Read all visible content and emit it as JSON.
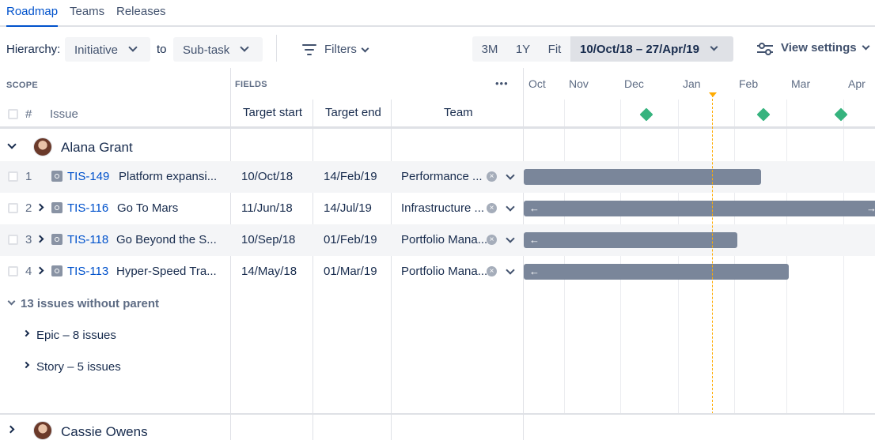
{
  "tabs": [
    {
      "label": "Roadmap",
      "active": true
    },
    {
      "label": "Teams",
      "active": false
    },
    {
      "label": "Releases",
      "active": false
    }
  ],
  "toolbar": {
    "hierarchy_label": "Hierarchy:",
    "hierarchy_from": "Initiative",
    "to_label": "to",
    "hierarchy_to": "Sub-task",
    "filters_label": "Filters",
    "range_3m": "3M",
    "range_1y": "1Y",
    "range_fit": "Fit",
    "date_range": "10/Oct/18 – 27/Apr/19",
    "view_settings": "View settings"
  },
  "columns": {
    "scope": "SCOPE",
    "fields": "FIELDS",
    "hash": "#",
    "issue": "Issue",
    "target_start": "Target start",
    "target_end": "Target end",
    "team": "Team",
    "more": "•••"
  },
  "months": [
    "Oct",
    "Nov",
    "Dec",
    "Jan",
    "Feb",
    "Mar",
    "Apr"
  ],
  "groups": [
    {
      "name": "Alana Grant",
      "expanded": true,
      "rows": [
        {
          "num": "1",
          "key": "TIS-149",
          "summary": "Platform expansi...",
          "start": "10/Oct/18",
          "end": "14/Feb/19",
          "team": "Performance ...",
          "has_children": false
        },
        {
          "num": "2",
          "key": "TIS-116",
          "summary": "Go To Mars",
          "start": "11/Jun/18",
          "end": "14/Jul/19",
          "team": "Infrastructure ...",
          "has_children": true
        },
        {
          "num": "3",
          "key": "TIS-118",
          "summary": "Go Beyond the S...",
          "start": "10/Sep/18",
          "end": "01/Feb/19",
          "team": "Portfolio Mana...",
          "has_children": true
        },
        {
          "num": "4",
          "key": "TIS-113",
          "summary": "Hyper-Speed Tra...",
          "start": "14/May/18",
          "end": "01/Mar/19",
          "team": "Portfolio Mana...",
          "has_children": true
        }
      ],
      "without_parent": "13 issues without parent",
      "sub_groups": [
        "Epic – 8 issues",
        "Story – 5 issues"
      ]
    },
    {
      "name": "Cassie Owens",
      "expanded": false
    }
  ],
  "icons": {
    "clear": "×",
    "bar_left": "←",
    "bar_right": "→"
  },
  "colors": {
    "accent": "#0052CC",
    "bar": "#7A869A",
    "milestone": "#36B37E",
    "today": "#FFAB00"
  }
}
